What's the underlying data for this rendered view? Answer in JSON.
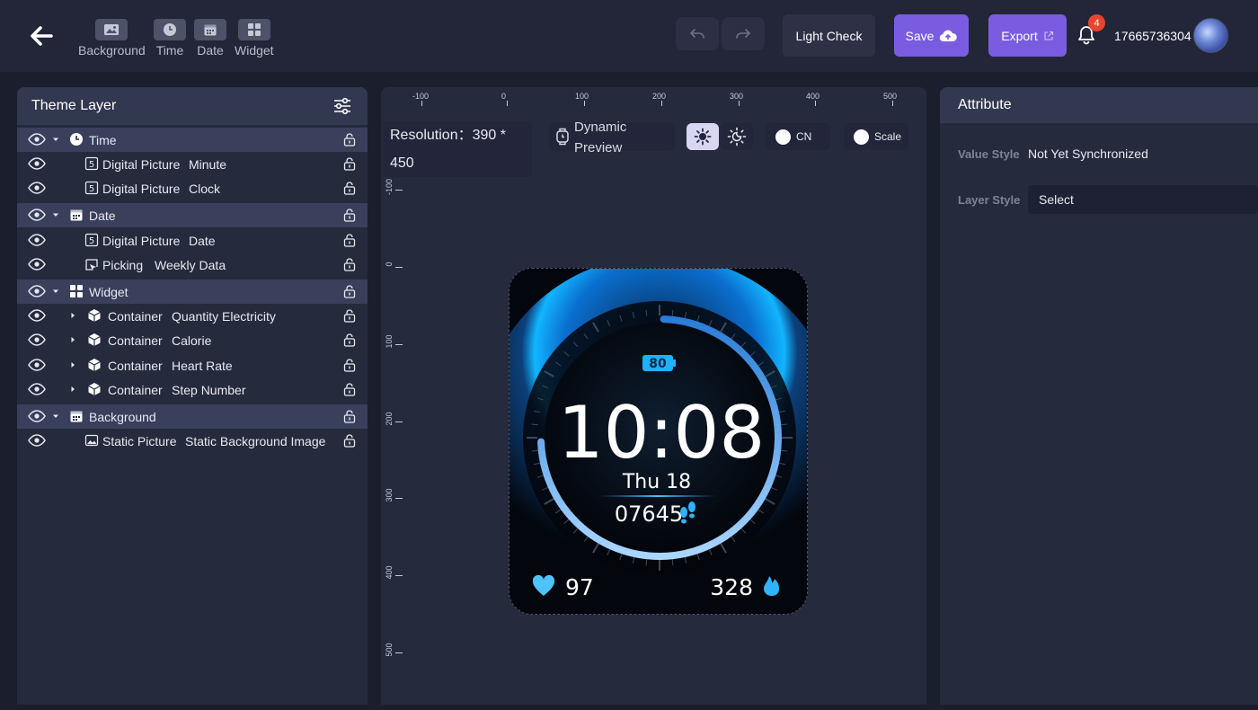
{
  "toolbar": {
    "tools": [
      {
        "label": "Background",
        "icon": "image-icon"
      },
      {
        "label": "Time",
        "icon": "clock-icon"
      },
      {
        "label": "Date",
        "icon": "calendar-icon"
      },
      {
        "label": "Widget",
        "icon": "grid-icon"
      }
    ],
    "light_check": "Light Check",
    "save": "Save",
    "export": "Export",
    "notifications": "4",
    "account": "17665736304",
    "accent": "#7a5ce0"
  },
  "layers": {
    "title": "Theme Layer",
    "rows": [
      {
        "kind": "group",
        "icon": "clock-icon",
        "label": "Time"
      },
      {
        "kind": "item",
        "icon": "digit-icon",
        "type": "Digital Picture",
        "name": "Minute"
      },
      {
        "kind": "item",
        "icon": "digit-icon",
        "type": "Digital Picture",
        "name": "Clock"
      },
      {
        "kind": "group",
        "icon": "calendar-icon",
        "label": "Date"
      },
      {
        "kind": "item",
        "icon": "digit-icon",
        "type": "Digital Picture",
        "name": "Date"
      },
      {
        "kind": "item",
        "icon": "picking-icon",
        "type": "Picking",
        "name": "Weekly Data"
      },
      {
        "kind": "group",
        "icon": "grid-icon",
        "label": "Widget"
      },
      {
        "kind": "container",
        "icon": "cube-icon",
        "type": "Container",
        "name": "Quantity Electricity"
      },
      {
        "kind": "container",
        "icon": "cube-icon",
        "type": "Container",
        "name": "Calorie"
      },
      {
        "kind": "container",
        "icon": "cube-icon",
        "type": "Container",
        "name": "Heart Rate"
      },
      {
        "kind": "container",
        "icon": "cube-icon",
        "type": "Container",
        "name": "Step Number"
      },
      {
        "kind": "group",
        "icon": "calendar-icon",
        "label": "Background"
      },
      {
        "kind": "item",
        "icon": "image-icon",
        "type": "Static Picture",
        "name": "Static Background Image"
      }
    ]
  },
  "canvas": {
    "ruler_x": [
      "-100",
      "0",
      "100",
      "200",
      "300",
      "400",
      "500"
    ],
    "ruler_y": [
      "-100",
      "0",
      "100",
      "200",
      "300",
      "400",
      "500"
    ],
    "resolution_line1": "Resolution：390 *",
    "resolution_line2": "450",
    "dynamic_preview_line1": "Dynamic",
    "dynamic_preview_line2": "Preview",
    "toggle_cn": "CN",
    "toggle_scale": "Scale",
    "watch": {
      "battery": "80",
      "time": "10:08",
      "date": "Thu 18",
      "steps": "07645",
      "heart_rate": "97",
      "calories": "328",
      "progress_fraction": 0.75
    }
  },
  "attribute": {
    "title": "Attribute",
    "value_style_label": "Value Style",
    "value_style_value": "Not Yet Synchronized",
    "layer_style_label": "Layer Style",
    "layer_style_value": "Select"
  }
}
